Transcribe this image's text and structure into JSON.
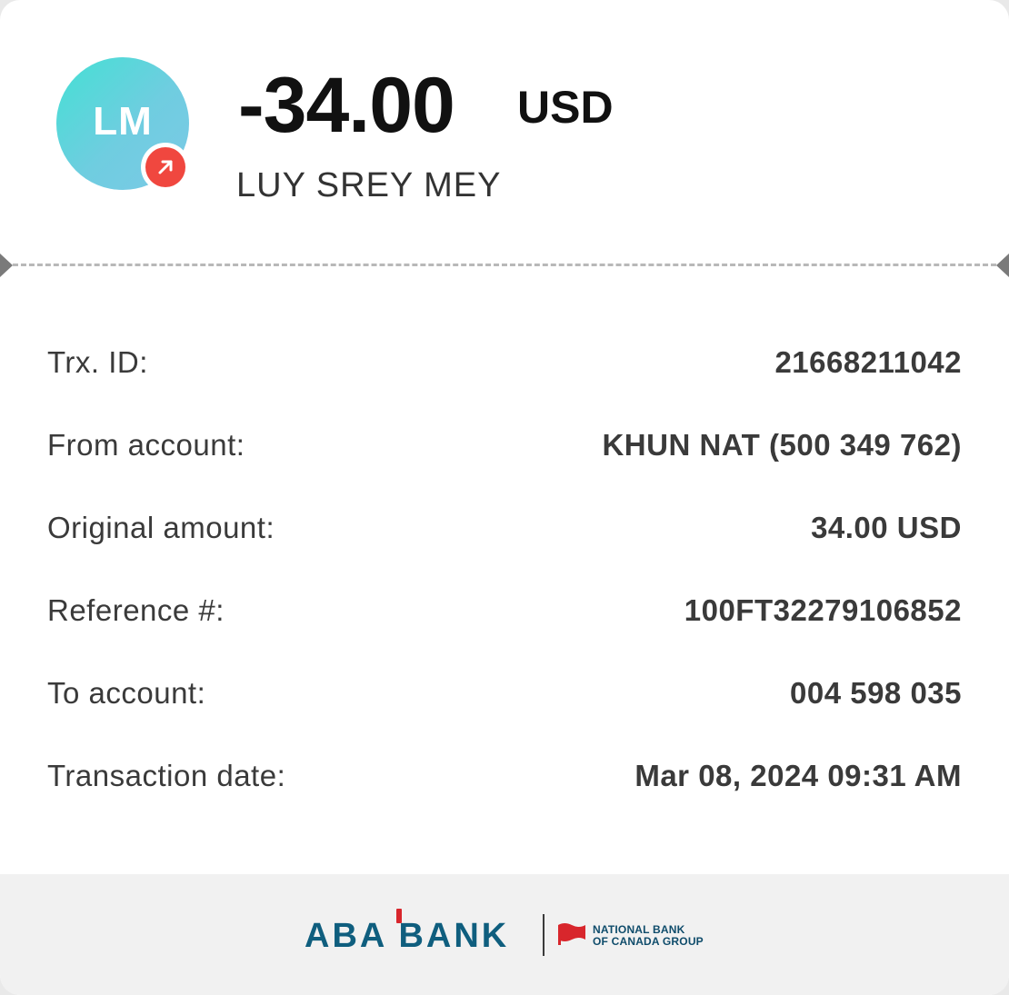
{
  "header": {
    "avatar_initials": "LM",
    "direction_icon": "arrow-up-right-icon",
    "amount": "-34.00",
    "currency": "USD",
    "recipient_name": "LUY SREY MEY"
  },
  "details": [
    {
      "label": "Trx. ID:",
      "value": "21668211042"
    },
    {
      "label": "From account:",
      "value": "KHUN NAT (500 349 762)"
    },
    {
      "label": "Original amount:",
      "value": "34.00 USD"
    },
    {
      "label": "Reference #:",
      "value": "100FT32279106852"
    },
    {
      "label": "To account:",
      "value": "004 598 035"
    },
    {
      "label": "Transaction date:",
      "value": "Mar 08, 2024 09:31 AM"
    }
  ],
  "footer": {
    "bank_logo_text": "ABA BANK",
    "partner_line1": "NATIONAL BANK",
    "partner_line2": "OF CANADA GROUP"
  },
  "colors": {
    "avatar_gradient_start": "#44e0d4",
    "avatar_gradient_end": "#7cc9e6",
    "badge_red": "#f0473f",
    "aba_blue": "#0f5e7e",
    "nbc_red": "#d8262c"
  }
}
